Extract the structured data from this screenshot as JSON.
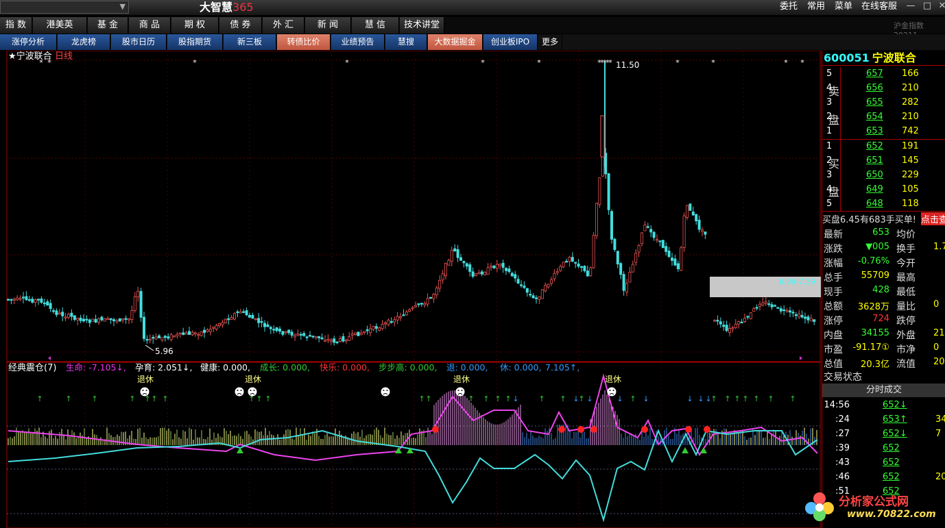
{
  "titlebar": {
    "brand": "大智慧",
    "brand_num": "365",
    "menus": [
      "委托",
      "常用",
      "菜单",
      "在线客服"
    ],
    "win": [
      "—",
      "□",
      "✕"
    ]
  },
  "nav1": [
    "指 数",
    "港美英",
    "基 金",
    "商 品",
    "期 权",
    "债 券",
    "外 汇",
    "新 闻",
    "慧 信",
    "技术讲堂"
  ],
  "nav1_right": "沪金指数20211",
  "nav2": [
    {
      "label": "涨停分析",
      "hl": false
    },
    {
      "label": "龙虎榜",
      "hl": false
    },
    {
      "label": "股市日历",
      "hl": false
    },
    {
      "label": "股指期货",
      "hl": false
    },
    {
      "label": "新三板",
      "hl": false
    },
    {
      "label": "转债比价",
      "hl": true
    },
    {
      "label": "业绩预告",
      "hl": false
    },
    {
      "label": "慧搜",
      "hl": false
    },
    {
      "label": "大数据掘金",
      "hl": true
    },
    {
      "label": "创业板IPO",
      "hl": false
    },
    {
      "label": "更多",
      "hl": false
    }
  ],
  "main_chart": {
    "title": "★宁波联合",
    "period": "日线",
    "high_label": "11.50",
    "low_label": "5.96",
    "range_label": "6.99-7.39"
  },
  "indicator": {
    "name": "经典震仓(7)",
    "items": [
      {
        "text": "生命: -7.105↓,",
        "color": "#e3e"
      },
      {
        "text": "孕育: 2.051↓,",
        "color": "#fff"
      },
      {
        "text": "健康: 0.000,",
        "color": "#fff"
      },
      {
        "text": "成长: 0.000,",
        "color": "#3c3"
      },
      {
        "text": "快乐: 0.000,",
        "color": "#f33"
      },
      {
        "text": "步步高: 0.000,",
        "color": "#3c3"
      },
      {
        "text": "退: 0.000,",
        "color": "#39f"
      },
      {
        "text": "休: 0.000,",
        "color": "#39f"
      },
      {
        "text": "7.105↑,",
        "color": "#39f"
      }
    ],
    "retire_label": "退休"
  },
  "quote": {
    "code": "600051",
    "name": "宁波联合",
    "sell_label": [
      "卖",
      "盘"
    ],
    "buy_label": [
      "买",
      "盘"
    ],
    "sell": [
      {
        "lv": "5",
        "p": "657",
        "v": "166"
      },
      {
        "lv": "4",
        "p": "656",
        "v": "210"
      },
      {
        "lv": "3",
        "p": "655",
        "v": "282"
      },
      {
        "lv": "2",
        "p": "654",
        "v": "210"
      },
      {
        "lv": "1",
        "p": "653",
        "v": "742"
      }
    ],
    "buy": [
      {
        "lv": "1",
        "p": "652",
        "v": "191"
      },
      {
        "lv": "2",
        "p": "651",
        "v": "145"
      },
      {
        "lv": "3",
        "p": "650",
        "v": "229"
      },
      {
        "lv": "4",
        "p": "649",
        "v": "105"
      },
      {
        "lv": "5",
        "p": "648",
        "v": "118"
      }
    ],
    "notice": "买盘6.45有683手买单!",
    "notice_btn": "点击查",
    "stats": [
      {
        "l": "最新",
        "v": "653",
        "vc": "grn",
        "l2": "均价",
        "v2": ""
      },
      {
        "l": "涨跌",
        "v": "▼005",
        "vc": "grn",
        "l2": "换手",
        "v2": "1.7"
      },
      {
        "l": "涨幅",
        "v": "-0.76%",
        "vc": "grn",
        "l2": "今开",
        "v2": ""
      },
      {
        "l": "总手",
        "v": "55709",
        "vc": "yel",
        "l2": "最高",
        "v2": ""
      },
      {
        "l": "现手",
        "v": "428",
        "vc": "grn",
        "l2": "最低",
        "v2": ""
      },
      {
        "l": "总额",
        "v": "3628万",
        "vc": "yel",
        "l2": "量比",
        "v2": "0"
      },
      {
        "l": "涨停",
        "v": "724",
        "vc": "red",
        "l2": "跌停",
        "v2": ""
      },
      {
        "l": "内盘",
        "v": "34155",
        "vc": "grn",
        "l2": "外盘",
        "v2": "21"
      },
      {
        "l": "市盈",
        "v": "-91.17①",
        "vc": "yel",
        "l2": "市净",
        "v2": "0"
      },
      {
        "l": "总值",
        "v": "20.3亿",
        "vc": "yel",
        "l2": "流值",
        "v2": "20."
      }
    ],
    "state": "交易状态",
    "ticks_title": "分时成交",
    "ticks": [
      {
        "t": "14:56",
        "p": "652↓",
        "v": ""
      },
      {
        "t": ":24",
        "p": "653↑",
        "v": "34"
      },
      {
        "t": ":27",
        "p": "652↓",
        "v": "7"
      },
      {
        "t": ":39",
        "p": "652",
        "v": ""
      },
      {
        "t": ":43",
        "p": "652",
        "v": ""
      },
      {
        "t": ":46",
        "p": "652",
        "v": "20"
      },
      {
        "t": ":51",
        "p": "652",
        "v": ""
      }
    ]
  },
  "watermark": {
    "text": "分析家公式网",
    "url": "www.70822.com"
  }
}
